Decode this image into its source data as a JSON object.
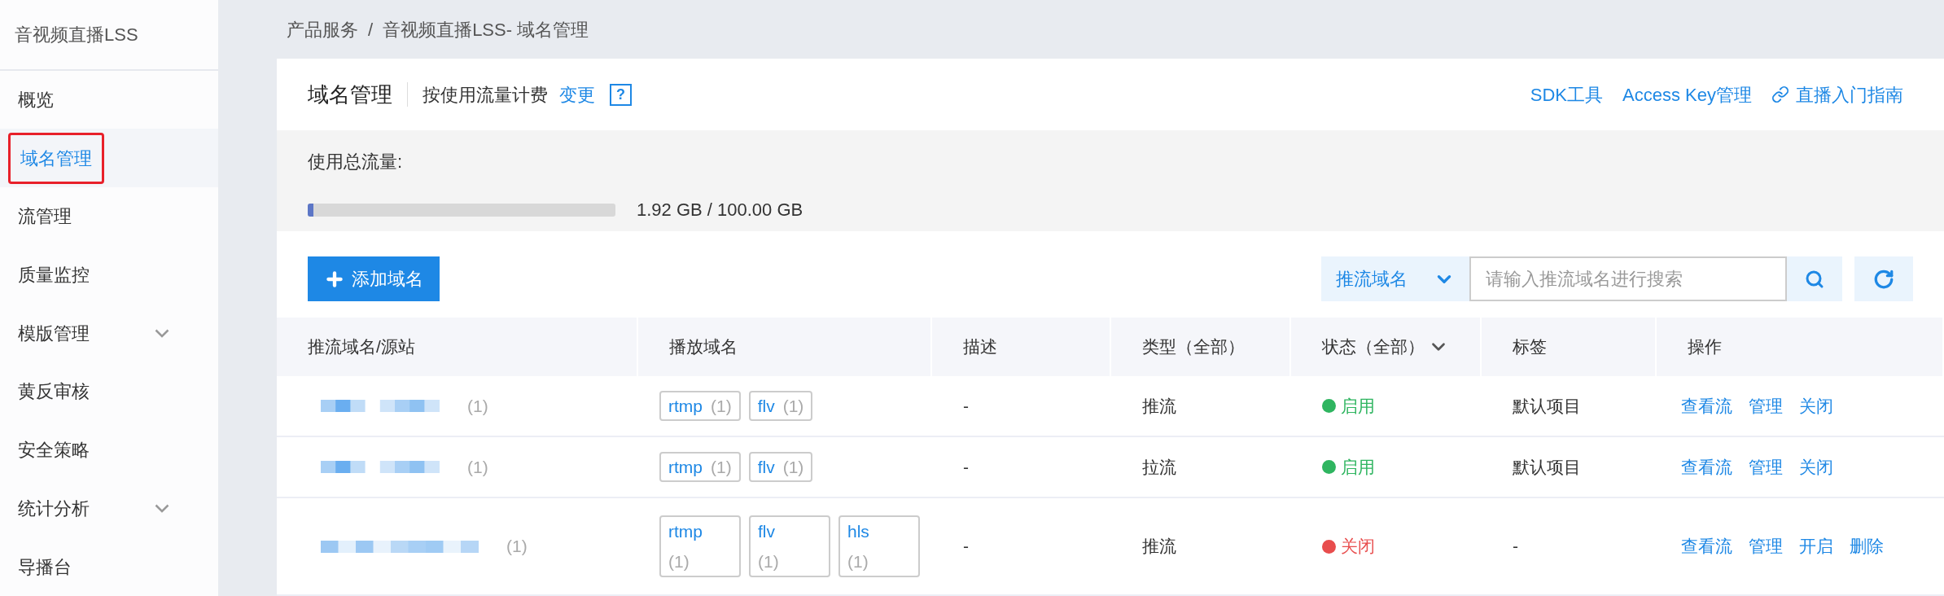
{
  "sidebar": {
    "title": "音视频直播LSS",
    "items": [
      {
        "label": "概览",
        "selected": false,
        "expandable": false
      },
      {
        "label": "域名管理",
        "selected": true,
        "expandable": false
      },
      {
        "label": "流管理",
        "selected": false,
        "expandable": false
      },
      {
        "label": "质量监控",
        "selected": false,
        "expandable": false
      },
      {
        "label": "模版管理",
        "selected": false,
        "expandable": true
      },
      {
        "label": "黄反审核",
        "selected": false,
        "expandable": false
      },
      {
        "label": "安全策略",
        "selected": false,
        "expandable": false
      },
      {
        "label": "统计分析",
        "selected": false,
        "expandable": true
      },
      {
        "label": "导播台",
        "selected": false,
        "expandable": false
      }
    ]
  },
  "breadcrumb": [
    "产品服务",
    "/",
    "音视频直播LSS- 域名管理"
  ],
  "header": {
    "title": "域名管理",
    "billing": "按使用流量计费",
    "change_link": "变更",
    "help": "?",
    "links": [
      "SDK工具",
      "Access Key管理",
      "直播入门指南"
    ]
  },
  "usage": {
    "label": "使用总流量:",
    "level": 0.0192,
    "reading": "1.92 GB / 100.00 GB"
  },
  "toolbar": {
    "add_button": "添加域名",
    "search_type": "推流域名",
    "placeholder": "请输入推流域名进行搜索"
  },
  "table": {
    "columns": [
      "推流域名/源站",
      "播放域名",
      "描述",
      "类型（全部）",
      "状态（全部）",
      "标签",
      "操作"
    ],
    "rows": [
      {
        "domain_count": "(1)",
        "play": [
          {
            "protocol": "rtmp",
            "count": "(1)"
          },
          {
            "protocol": "flv",
            "count": "(1)"
          }
        ],
        "description": "-",
        "type": "推流",
        "status": {
          "label": "启用",
          "color": "#2fb560"
        },
        "tag": "默认项目",
        "actions": [
          "查看流",
          "管理",
          "关闭"
        ]
      },
      {
        "domain_count": "(1)",
        "play": [
          {
            "protocol": "rtmp",
            "count": "(1)"
          },
          {
            "protocol": "flv",
            "count": "(1)"
          }
        ],
        "description": "-",
        "type": "拉流",
        "status": {
          "label": "启用",
          "color": "#2fb560"
        },
        "tag": "默认项目",
        "actions": [
          "查看流",
          "管理",
          "关闭"
        ]
      },
      {
        "domain_count": "(1)",
        "play": [
          {
            "protocol": "rtmp",
            "count": "(1)"
          },
          {
            "protocol": "flv",
            "count": "(1)"
          },
          {
            "protocol": "hls",
            "count": "(1)"
          }
        ],
        "description": "-",
        "type": "推流",
        "status": {
          "label": "关闭",
          "color": "#e84d4d"
        },
        "tag": "-",
        "actions": [
          "查看流",
          "管理",
          "开启",
          "删除"
        ]
      }
    ]
  }
}
